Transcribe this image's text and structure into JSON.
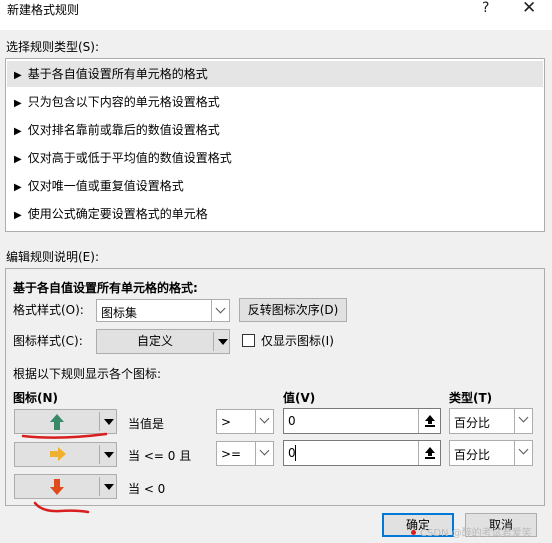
{
  "window": {
    "title": "新建格式规则",
    "help_label": "?",
    "close_label": "✕"
  },
  "rule_types": {
    "label": "选择规则类型(S):",
    "items": [
      {
        "label": "基于各自值设置所有单元格的格式",
        "selected": true
      },
      {
        "label": "只为包含以下内容的单元格设置格式",
        "selected": false
      },
      {
        "label": "仅对排名靠前或靠后的数值设置格式",
        "selected": false
      },
      {
        "label": "仅对高于或低于平均值的数值设置格式",
        "selected": false
      },
      {
        "label": "仅对唯一值或重复值设置格式",
        "selected": false
      },
      {
        "label": "使用公式确定要设置格式的单元格",
        "selected": false
      }
    ],
    "arrow": "▶"
  },
  "description": {
    "label": "编辑规则说明(E):",
    "heading": "基于各自值设置所有单元格的格式:",
    "format_style_label": "格式样式(O):",
    "format_style_value": "图标集",
    "reverse_button": "反转图标次序(D)",
    "icon_style_label": "图标样式(C):",
    "icon_style_value": "自定义",
    "show_icon_only_label": "仅显示图标(I)",
    "show_icon_only_checked": false,
    "rules_caption": "根据以下规则显示各个图标:",
    "col_icon": "图标(N)",
    "col_value": "值(V)",
    "col_type": "类型(T)",
    "rows": [
      {
        "icon": "green-up-arrow",
        "condition": "当值是",
        "operator": ">",
        "value": "0",
        "type": "百分比"
      },
      {
        "icon": "yellow-right-arrow",
        "condition": "当 <= 0 且",
        "operator": ">=",
        "value": "0",
        "type": "百分比"
      },
      {
        "icon": "red-down-arrow",
        "condition": "当 < 0"
      }
    ]
  },
  "footer": {
    "ok_label": "确定",
    "cancel_label": "取消",
    "watermark": "CSDN @醉的考试君爱笑"
  },
  "colors": {
    "accent": "#0078d7",
    "green_arrow": "#3a8a6a",
    "yellow_arrow": "#f0b030",
    "red_arrow": "#e04a1c",
    "annotation_red": "#d81e1e"
  }
}
